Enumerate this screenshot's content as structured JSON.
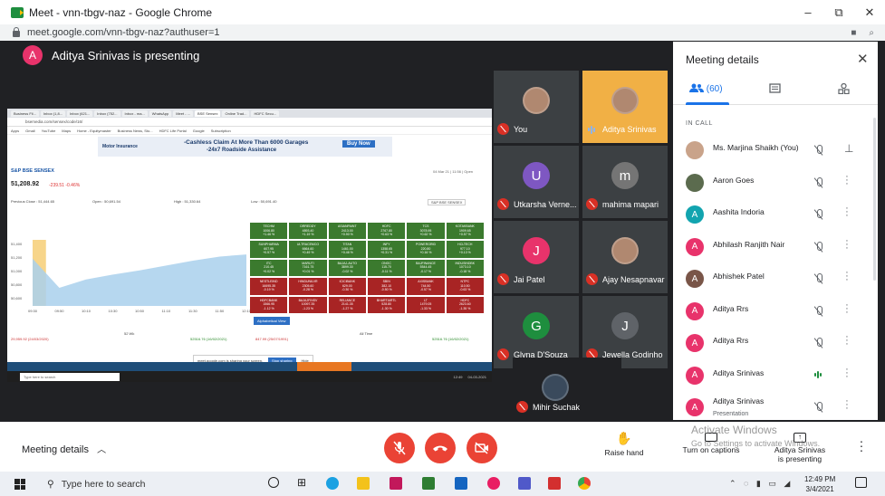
{
  "browser": {
    "title": "Meet - vnn-tbgv-naz - Google Chrome",
    "url": "meet.google.com/vnn-tbgv-naz?authuser=1",
    "controls": [
      "–",
      "⧉",
      "✕"
    ]
  },
  "presenter": {
    "initial": "A",
    "banner": "Aditya Srinivas is presenting"
  },
  "shared_screen": {
    "tabs": [
      "Business Fil...",
      "Inbox (1,8...",
      "Inbox (621...",
      "Inbox (752...",
      "Inbox - ma...",
      "WhatsApp",
      "Meet - ...",
      "BSE Sensex",
      "Online Trad...",
      "HDFC Secu..."
    ],
    "address": "bsemedia.com/sensex/code/16/",
    "bookmarks": [
      "Apps",
      "Gmail",
      "YouTube",
      "Maps",
      "Home - Equitymaster",
      "Business News, Sto...",
      "HDFC Life Portal",
      "Google",
      "Subscription"
    ],
    "ad_line1": "-Cashless Claim At More Than 6000 Garages",
    "ad_line2": "-24x7 Roadside Assistance",
    "ad_button": "Buy Now",
    "ad_brand": "Motor Insurance",
    "index_name": "S&P BSE SENSEX",
    "index_value": "51,208.92",
    "index_change": "-239.51 -0.46%",
    "as_of": "04 Mar 21 | 11:56 | Open",
    "prev_close": "Previous Close : 51,444.65",
    "open": "Open : 50,691.54",
    "high": "High : 51,330.64",
    "low": "Low : 50,691.40",
    "index_select": "S&P BSE SENSEX",
    "chart_data": {
      "type": "area",
      "x": [
        "09:30",
        "09:50",
        "10:10",
        "10:30",
        "10:50",
        "11:10",
        "11:30",
        "11:50",
        "12:10"
      ],
      "values": [
        51180,
        50760,
        50880,
        50950,
        51010,
        51080,
        51150,
        51210,
        51240
      ],
      "y_ticks": [
        "51,400",
        "51,200",
        "51,000",
        "50,800",
        "50,600"
      ],
      "ylim": [
        50500,
        51450
      ]
    },
    "heatmap": [
      {
        "n": "TECHM",
        "v": "1006.80",
        "c": "+1.46 %",
        "s": "g"
      },
      {
        "n": "DRREDDY",
        "v": "4893.40",
        "c": "+1.19 %",
        "s": "g"
      },
      {
        "n": "ASIANPAINT",
        "v": "2413.00",
        "c": "+0.90 %",
        "s": "g"
      },
      {
        "n": "HDFC",
        "v": "2767.80",
        "c": "+0.63 %",
        "s": "g"
      },
      {
        "n": "TCS",
        "v": "3078.95",
        "c": "+0.62 %",
        "s": "g"
      },
      {
        "n": "KOTAKBANK",
        "v": "1909.65",
        "c": "+0.57 %",
        "s": "g"
      },
      {
        "n": "SUNPHARMA",
        "v": "607.95",
        "c": "+0.57 %",
        "s": "g"
      },
      {
        "n": "ULTRACEMCO",
        "v": "6664.60",
        "c": "+0.49 %",
        "s": "g"
      },
      {
        "n": "TITAN",
        "v": "1461.00",
        "c": "+0.46 %",
        "s": "g"
      },
      {
        "n": "INFY",
        "v": "1358.65",
        "c": "+0.31 %",
        "s": "g"
      },
      {
        "n": "POWERGRID",
        "v": "220.80",
        "c": "+0.16 %",
        "s": "g"
      },
      {
        "n": "HCLTECH",
        "v": "977.10",
        "c": "+0.13 %",
        "s": "g"
      },
      {
        "n": "ITC",
        "v": "210.45",
        "c": "+0.02 %",
        "s": "g"
      },
      {
        "n": "MARUTI",
        "v": "7161.75",
        "c": "+0.01 %",
        "s": "g"
      },
      {
        "n": "BAJAJ-AUTO",
        "v": "3899.30",
        "c": "-0.02 %",
        "s": "g"
      },
      {
        "n": "ONGC",
        "v": "115.70",
        "c": "-0.11 %",
        "s": "g"
      },
      {
        "n": "BAJFINANCE",
        "v": "5544.45",
        "c": "-0.17 %",
        "s": "g"
      },
      {
        "n": "INDUSINDBK",
        "v": "1073.10",
        "c": "-0.18 %",
        "s": "g"
      },
      {
        "n": "NESTLEIND",
        "v": "16695.35",
        "c": "-0.19 %",
        "s": "r"
      },
      {
        "n": "HINDUNILVR",
        "v": "2305.60",
        "c": "-0.28 %",
        "s": "r"
      },
      {
        "n": "ICICIBANK",
        "v": "629.00",
        "c": "-0.30 %",
        "s": "r"
      },
      {
        "n": "SBIN",
        "v": "382.10",
        "c": "-0.50 %",
        "s": "r"
      },
      {
        "n": "AXISBANK",
        "v": "744.50",
        "c": "-0.57 %",
        "s": "r"
      },
      {
        "n": "NTPC",
        "v": "110.50",
        "c": "-0.63 %",
        "s": "r"
      },
      {
        "n": "HDFCBANK",
        "v": "1566.95",
        "c": "-1.12 %",
        "s": "r"
      },
      {
        "n": "BAJAJFINSV",
        "v": "10097.35",
        "c": "-1.23 %",
        "s": "r"
      },
      {
        "n": "RELIANCE",
        "v": "2141.35",
        "c": "-1.27 %",
        "s": "r"
      },
      {
        "n": "BHARTIARTL",
        "v": "528.80",
        "c": "-1.30 %",
        "s": "r"
      },
      {
        "n": "LT",
        "v": "1479.05",
        "c": "-1.33 %",
        "s": "r"
      },
      {
        "n": "HDFC",
        "v": "2623.60",
        "c": "-1.35 %",
        "s": "r"
      }
    ],
    "alpha_button": "Alphabetical View",
    "range_low": "29,959.92 (24/03/2020)",
    "range_52wk": "52 Wk",
    "range_high": "52516.76 (16/02/2021)",
    "range_low2": "847.99 (25/07/1991)",
    "range_alltime": "All Time",
    "range_high2": "52516.76 (16/02/2021)",
    "share_text": "meet.google.com is sharing your screen.",
    "share_stop": "Stop sharing",
    "share_hide": "Hide",
    "inner_search": "Type here to search",
    "inner_time": "12:49",
    "inner_date": "04-03-2021"
  },
  "participants": [
    {
      "name": "You",
      "initial": "",
      "color": "#3c4043",
      "muted": true,
      "photo": true
    },
    {
      "name": "Aditya Srinivas",
      "initial": "",
      "color": "#ef8a17",
      "muted": false,
      "speaking": true,
      "photo": true
    },
    {
      "name": "Utkarsha Verne...",
      "initial": "U",
      "color": "#7e57c2",
      "muted": true
    },
    {
      "name": "mahima mapari",
      "initial": "m",
      "color": "#757575",
      "muted": true
    },
    {
      "name": "Jai Patel",
      "initial": "J",
      "color": "#e8336b",
      "muted": true
    },
    {
      "name": "Ajay Nesapnavar",
      "initial": "",
      "color": "#5f6368",
      "muted": true,
      "photo": true
    },
    {
      "name": "Glyna D'Souza",
      "initial": "G",
      "color": "#1e8e3e",
      "muted": true
    },
    {
      "name": "Jewella Godinho",
      "initial": "J",
      "color": "#5f6368",
      "muted": true
    },
    {
      "name": "Mihir Suchak",
      "initial": "",
      "color": "#202124",
      "muted": true,
      "photo": true
    }
  ],
  "panel": {
    "title": "Meeting details",
    "close": "✕",
    "people_count": "(60)",
    "section": "IN CALL",
    "people": [
      {
        "name": "Ms. Marjina Shaikh (You)",
        "initial": "",
        "color": "#c9a38a",
        "pin": true
      },
      {
        "name": "Aaron Goes",
        "initial": "",
        "color": "#5b6b4e"
      },
      {
        "name": "Aashita Indoria",
        "initial": "A",
        "color": "#12a4af"
      },
      {
        "name": "Abhilash Ranjith Nair",
        "initial": "A",
        "color": "#e8336b"
      },
      {
        "name": "Abhishek Patel",
        "initial": "A",
        "color": "#795548"
      },
      {
        "name": "Aditya Rrs",
        "initial": "A",
        "color": "#e8336b"
      },
      {
        "name": "Aditya Rrs",
        "initial": "A",
        "color": "#e8336b"
      },
      {
        "name": "Aditya Srinivas",
        "initial": "A",
        "color": "#e8336b",
        "speaking": true
      },
      {
        "name": "Aditya Srinivas",
        "initial": "A",
        "color": "#e8336b",
        "sub": "Presentation",
        "presenting": true
      }
    ]
  },
  "bottombar": {
    "meeting_details": "Meeting details",
    "raise_hand": "Raise hand",
    "captions": "Turn on captions",
    "presenting_line1": "Aditya Srinivas",
    "presenting_line2": "is presenting",
    "activate_title": "Activate Windows",
    "activate_sub": "Go to Settings to activate Windows."
  },
  "taskbar": {
    "search": "Type here to search",
    "time": "12:49 PM",
    "date": "3/4/2021"
  }
}
